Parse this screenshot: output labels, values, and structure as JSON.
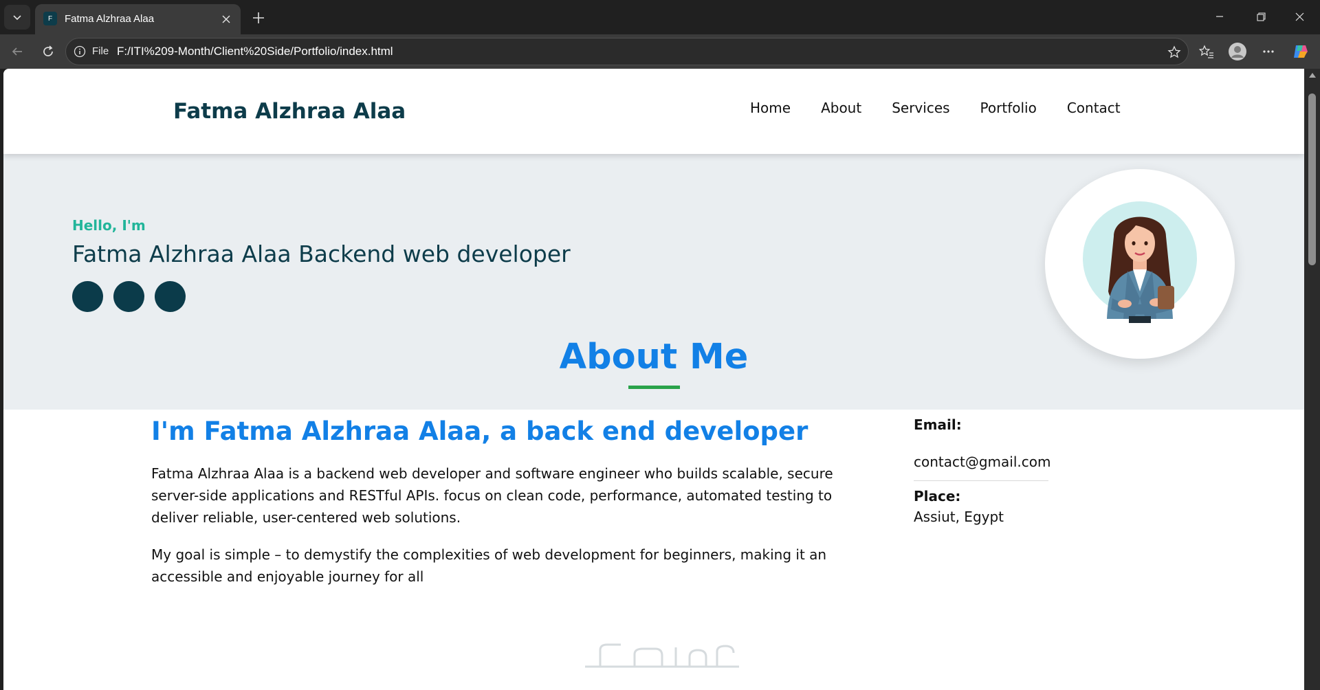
{
  "browser": {
    "tab_title": "Fatma Alzhraa Alaa",
    "favicon_letter": "F",
    "address_label": "File",
    "url": "F:/ITI%209-Month/Client%20Side/Portfolio/index.html"
  },
  "site": {
    "brand": "Fatma Alzhraa Alaa",
    "nav": [
      "Home",
      "About",
      "Services",
      "Portfolio",
      "Contact"
    ]
  },
  "hero": {
    "greeting": "Hello, I'm",
    "headline": "Fatma Alzhraa Alaa Backend web developer",
    "social_count": 3
  },
  "about": {
    "title": "About Me",
    "subtitle": "I'm Fatma Alzhraa Alaa, a back end developer",
    "paragraph1": "Fatma Alzhraa Alaa is a backend web developer and software engineer who builds scalable, secure server-side applications and RESTful APIs. focus on clean code, performance, automated testing to deliver reliable, user-centered web solutions.",
    "paragraph2": "My goal is simple – to demystify the complexities of web development for beginners, making it an accessible and enjoyable journey for all",
    "email_label": "Email:",
    "email_value": "contact@gmail.com",
    "place_label": "Place:",
    "place_value": "Assiut, Egypt"
  },
  "colors": {
    "brand_dark": "#0d3c4a",
    "accent_green": "#22b59a",
    "title_blue": "#1280e6",
    "underline_green": "#2aa34a",
    "hero_bg": "#eaeef1"
  }
}
